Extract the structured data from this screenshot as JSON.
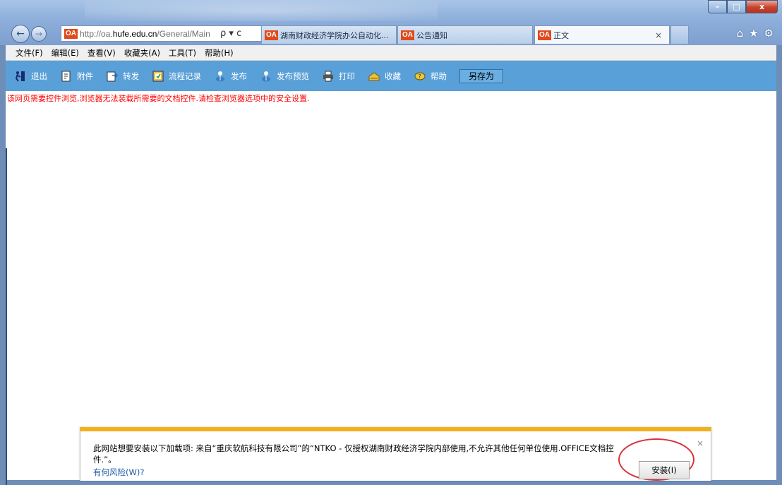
{
  "window": {
    "controls": {
      "minimize": "–",
      "maximize": "□",
      "close": "x"
    }
  },
  "nav": {
    "back_icon": "←",
    "forward_icon": "→",
    "address": {
      "badge": "OA",
      "url_prefix": "http://oa.",
      "url_domain": "hufe.edu.cn",
      "url_suffix": "/General/Main",
      "search_icon": "ρ",
      "dropdown_icon": "▾",
      "refresh_icon": "c"
    }
  },
  "tabs": [
    {
      "badge": "OA",
      "label": "湖南财政经济学院办公自动化...",
      "active": false
    },
    {
      "badge": "OA",
      "label": "公告通知",
      "active": false
    },
    {
      "badge": "OA",
      "label": "正文",
      "active": true,
      "close": "×"
    }
  ],
  "right_icons": {
    "home": "⌂",
    "favorites": "★",
    "settings": "⚙"
  },
  "menu": [
    "文件(F)",
    "编辑(E)",
    "查看(V)",
    "收藏夹(A)",
    "工具(T)",
    "帮助(H)"
  ],
  "toolbar": {
    "items": [
      {
        "label": "退出",
        "icon": "exit-icon"
      },
      {
        "label": "附件",
        "icon": "attachment-icon"
      },
      {
        "label": "转发",
        "icon": "forward-doc-icon"
      },
      {
        "label": "流程记录",
        "icon": "flow-record-icon"
      },
      {
        "label": "发布",
        "icon": "publish-icon"
      },
      {
        "label": "发布预览",
        "icon": "publish-preview-icon"
      },
      {
        "label": "打印",
        "icon": "print-icon"
      },
      {
        "label": "收藏",
        "icon": "favorite-icon"
      },
      {
        "label": "帮助",
        "icon": "help-icon"
      }
    ],
    "save_as": "另存为"
  },
  "warning": "该网页需要控件浏览,浏览器无法装载所需要的文档控件.请检查浏览器选项中的安全设置.",
  "notification": {
    "message": "此网站想要安装以下加载项: 来自“重庆软航科技有限公司”的“NTKO - 仅授权湖南财政经济学院内部使用,不允许其他任何单位使用.OFFICE文档控件.”。",
    "link": "有何风险(W)?",
    "install_label": "安装(I)",
    "close": "×",
    "accent_color": "#f2b01b"
  }
}
